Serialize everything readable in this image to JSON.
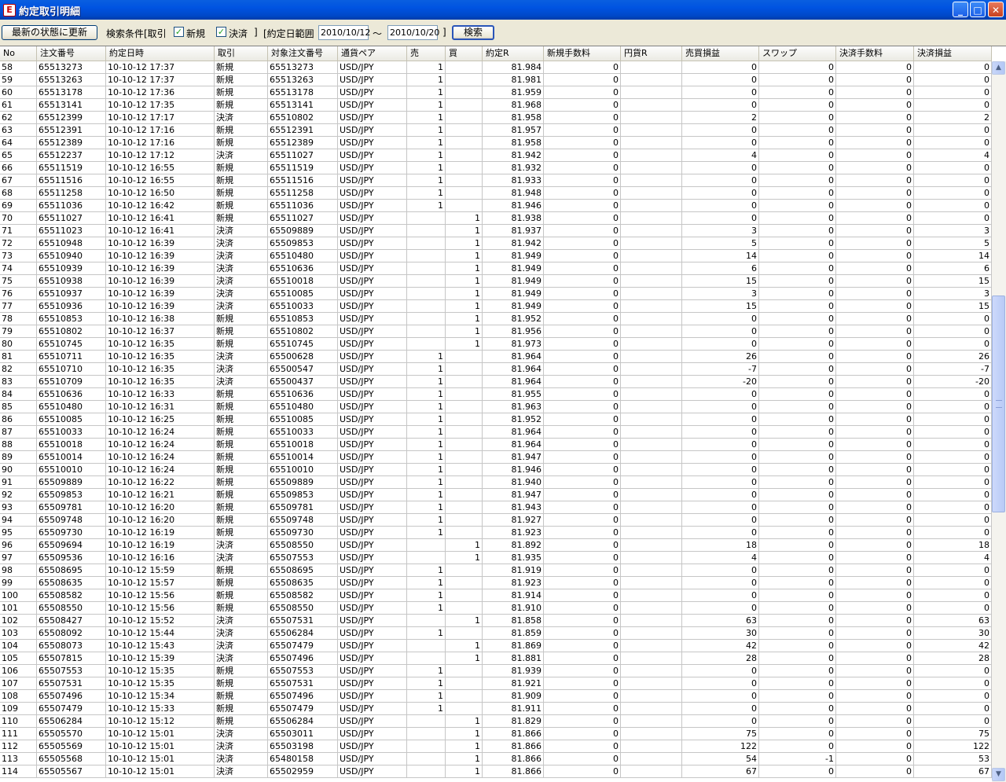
{
  "window": {
    "title": "約定取引明細"
  },
  "toolbar": {
    "refresh_label": "最新の状態に更新",
    "search_condition_label": "検索条件[取引",
    "new_checked": true,
    "new_label": "新規",
    "settle_checked": true,
    "settle_label": "決済",
    "bracket_close": "]",
    "date_range_label": "[約定日範囲",
    "date_from": "2010/10/12",
    "tilde": "〜",
    "date_to": "2010/10/20",
    "bracket_close2": "]",
    "search_label": "検索"
  },
  "table": {
    "columns": [
      "No",
      "注文番号",
      "約定日時",
      "取引",
      "対象注文番号",
      "通貨ペア",
      "売",
      "買",
      "約定R",
      "新規手数料",
      "円貨R",
      "売買損益",
      "スワップ",
      "決済手数料",
      "決済損益"
    ],
    "rows": [
      [
        "58",
        "65513273",
        "10-10-12 17:37",
        "新規",
        "65513273",
        "USD/JPY",
        "1",
        "",
        "81.984",
        "0",
        "",
        "0",
        "0",
        "0",
        "0"
      ],
      [
        "59",
        "65513263",
        "10-10-12 17:37",
        "新規",
        "65513263",
        "USD/JPY",
        "1",
        "",
        "81.981",
        "0",
        "",
        "0",
        "0",
        "0",
        "0"
      ],
      [
        "60",
        "65513178",
        "10-10-12 17:36",
        "新規",
        "65513178",
        "USD/JPY",
        "1",
        "",
        "81.959",
        "0",
        "",
        "0",
        "0",
        "0",
        "0"
      ],
      [
        "61",
        "65513141",
        "10-10-12 17:35",
        "新規",
        "65513141",
        "USD/JPY",
        "1",
        "",
        "81.968",
        "0",
        "",
        "0",
        "0",
        "0",
        "0"
      ],
      [
        "62",
        "65512399",
        "10-10-12 17:17",
        "決済",
        "65510802",
        "USD/JPY",
        "1",
        "",
        "81.958",
        "0",
        "",
        "2",
        "0",
        "0",
        "2"
      ],
      [
        "63",
        "65512391",
        "10-10-12 17:16",
        "新規",
        "65512391",
        "USD/JPY",
        "1",
        "",
        "81.957",
        "0",
        "",
        "0",
        "0",
        "0",
        "0"
      ],
      [
        "64",
        "65512389",
        "10-10-12 17:16",
        "新規",
        "65512389",
        "USD/JPY",
        "1",
        "",
        "81.958",
        "0",
        "",
        "0",
        "0",
        "0",
        "0"
      ],
      [
        "65",
        "65512237",
        "10-10-12 17:12",
        "決済",
        "65511027",
        "USD/JPY",
        "1",
        "",
        "81.942",
        "0",
        "",
        "4",
        "0",
        "0",
        "4"
      ],
      [
        "66",
        "65511519",
        "10-10-12 16:55",
        "新規",
        "65511519",
        "USD/JPY",
        "1",
        "",
        "81.932",
        "0",
        "",
        "0",
        "0",
        "0",
        "0"
      ],
      [
        "67",
        "65511516",
        "10-10-12 16:55",
        "新規",
        "65511516",
        "USD/JPY",
        "1",
        "",
        "81.933",
        "0",
        "",
        "0",
        "0",
        "0",
        "0"
      ],
      [
        "68",
        "65511258",
        "10-10-12 16:50",
        "新規",
        "65511258",
        "USD/JPY",
        "1",
        "",
        "81.948",
        "0",
        "",
        "0",
        "0",
        "0",
        "0"
      ],
      [
        "69",
        "65511036",
        "10-10-12 16:42",
        "新規",
        "65511036",
        "USD/JPY",
        "1",
        "",
        "81.946",
        "0",
        "",
        "0",
        "0",
        "0",
        "0"
      ],
      [
        "70",
        "65511027",
        "10-10-12 16:41",
        "新規",
        "65511027",
        "USD/JPY",
        "",
        "1",
        "81.938",
        "0",
        "",
        "0",
        "0",
        "0",
        "0"
      ],
      [
        "71",
        "65511023",
        "10-10-12 16:41",
        "決済",
        "65509889",
        "USD/JPY",
        "",
        "1",
        "81.937",
        "0",
        "",
        "3",
        "0",
        "0",
        "3"
      ],
      [
        "72",
        "65510948",
        "10-10-12 16:39",
        "決済",
        "65509853",
        "USD/JPY",
        "",
        "1",
        "81.942",
        "0",
        "",
        "5",
        "0",
        "0",
        "5"
      ],
      [
        "73",
        "65510940",
        "10-10-12 16:39",
        "決済",
        "65510480",
        "USD/JPY",
        "",
        "1",
        "81.949",
        "0",
        "",
        "14",
        "0",
        "0",
        "14"
      ],
      [
        "74",
        "65510939",
        "10-10-12 16:39",
        "決済",
        "65510636",
        "USD/JPY",
        "",
        "1",
        "81.949",
        "0",
        "",
        "6",
        "0",
        "0",
        "6"
      ],
      [
        "75",
        "65510938",
        "10-10-12 16:39",
        "決済",
        "65510018",
        "USD/JPY",
        "",
        "1",
        "81.949",
        "0",
        "",
        "15",
        "0",
        "0",
        "15"
      ],
      [
        "76",
        "65510937",
        "10-10-12 16:39",
        "決済",
        "65510085",
        "USD/JPY",
        "",
        "1",
        "81.949",
        "0",
        "",
        "3",
        "0",
        "0",
        "3"
      ],
      [
        "77",
        "65510936",
        "10-10-12 16:39",
        "決済",
        "65510033",
        "USD/JPY",
        "",
        "1",
        "81.949",
        "0",
        "",
        "15",
        "0",
        "0",
        "15"
      ],
      [
        "78",
        "65510853",
        "10-10-12 16:38",
        "新規",
        "65510853",
        "USD/JPY",
        "",
        "1",
        "81.952",
        "0",
        "",
        "0",
        "0",
        "0",
        "0"
      ],
      [
        "79",
        "65510802",
        "10-10-12 16:37",
        "新規",
        "65510802",
        "USD/JPY",
        "",
        "1",
        "81.956",
        "0",
        "",
        "0",
        "0",
        "0",
        "0"
      ],
      [
        "80",
        "65510745",
        "10-10-12 16:35",
        "新規",
        "65510745",
        "USD/JPY",
        "",
        "1",
        "81.973",
        "0",
        "",
        "0",
        "0",
        "0",
        "0"
      ],
      [
        "81",
        "65510711",
        "10-10-12 16:35",
        "決済",
        "65500628",
        "USD/JPY",
        "1",
        "",
        "81.964",
        "0",
        "",
        "26",
        "0",
        "0",
        "26"
      ],
      [
        "82",
        "65510710",
        "10-10-12 16:35",
        "決済",
        "65500547",
        "USD/JPY",
        "1",
        "",
        "81.964",
        "0",
        "",
        "-7",
        "0",
        "0",
        "-7"
      ],
      [
        "83",
        "65510709",
        "10-10-12 16:35",
        "決済",
        "65500437",
        "USD/JPY",
        "1",
        "",
        "81.964",
        "0",
        "",
        "-20",
        "0",
        "0",
        "-20"
      ],
      [
        "84",
        "65510636",
        "10-10-12 16:33",
        "新規",
        "65510636",
        "USD/JPY",
        "1",
        "",
        "81.955",
        "0",
        "",
        "0",
        "0",
        "0",
        "0"
      ],
      [
        "85",
        "65510480",
        "10-10-12 16:31",
        "新規",
        "65510480",
        "USD/JPY",
        "1",
        "",
        "81.963",
        "0",
        "",
        "0",
        "0",
        "0",
        "0"
      ],
      [
        "86",
        "65510085",
        "10-10-12 16:25",
        "新規",
        "65510085",
        "USD/JPY",
        "1",
        "",
        "81.952",
        "0",
        "",
        "0",
        "0",
        "0",
        "0"
      ],
      [
        "87",
        "65510033",
        "10-10-12 16:24",
        "新規",
        "65510033",
        "USD/JPY",
        "1",
        "",
        "81.964",
        "0",
        "",
        "0",
        "0",
        "0",
        "0"
      ],
      [
        "88",
        "65510018",
        "10-10-12 16:24",
        "新規",
        "65510018",
        "USD/JPY",
        "1",
        "",
        "81.964",
        "0",
        "",
        "0",
        "0",
        "0",
        "0"
      ],
      [
        "89",
        "65510014",
        "10-10-12 16:24",
        "新規",
        "65510014",
        "USD/JPY",
        "1",
        "",
        "81.947",
        "0",
        "",
        "0",
        "0",
        "0",
        "0"
      ],
      [
        "90",
        "65510010",
        "10-10-12 16:24",
        "新規",
        "65510010",
        "USD/JPY",
        "1",
        "",
        "81.946",
        "0",
        "",
        "0",
        "0",
        "0",
        "0"
      ],
      [
        "91",
        "65509889",
        "10-10-12 16:22",
        "新規",
        "65509889",
        "USD/JPY",
        "1",
        "",
        "81.940",
        "0",
        "",
        "0",
        "0",
        "0",
        "0"
      ],
      [
        "92",
        "65509853",
        "10-10-12 16:21",
        "新規",
        "65509853",
        "USD/JPY",
        "1",
        "",
        "81.947",
        "0",
        "",
        "0",
        "0",
        "0",
        "0"
      ],
      [
        "93",
        "65509781",
        "10-10-12 16:20",
        "新規",
        "65509781",
        "USD/JPY",
        "1",
        "",
        "81.943",
        "0",
        "",
        "0",
        "0",
        "0",
        "0"
      ],
      [
        "94",
        "65509748",
        "10-10-12 16:20",
        "新規",
        "65509748",
        "USD/JPY",
        "1",
        "",
        "81.927",
        "0",
        "",
        "0",
        "0",
        "0",
        "0"
      ],
      [
        "95",
        "65509730",
        "10-10-12 16:19",
        "新規",
        "65509730",
        "USD/JPY",
        "1",
        "",
        "81.923",
        "0",
        "",
        "0",
        "0",
        "0",
        "0"
      ],
      [
        "96",
        "65509694",
        "10-10-12 16:19",
        "決済",
        "65508550",
        "USD/JPY",
        "",
        "1",
        "81.892",
        "0",
        "",
        "18",
        "0",
        "0",
        "18"
      ],
      [
        "97",
        "65509536",
        "10-10-12 16:16",
        "決済",
        "65507553",
        "USD/JPY",
        "",
        "1",
        "81.935",
        "0",
        "",
        "4",
        "0",
        "0",
        "4"
      ],
      [
        "98",
        "65508695",
        "10-10-12 15:59",
        "新規",
        "65508695",
        "USD/JPY",
        "1",
        "",
        "81.919",
        "0",
        "",
        "0",
        "0",
        "0",
        "0"
      ],
      [
        "99",
        "65508635",
        "10-10-12 15:57",
        "新規",
        "65508635",
        "USD/JPY",
        "1",
        "",
        "81.923",
        "0",
        "",
        "0",
        "0",
        "0",
        "0"
      ],
      [
        "100",
        "65508582",
        "10-10-12 15:56",
        "新規",
        "65508582",
        "USD/JPY",
        "1",
        "",
        "81.914",
        "0",
        "",
        "0",
        "0",
        "0",
        "0"
      ],
      [
        "101",
        "65508550",
        "10-10-12 15:56",
        "新規",
        "65508550",
        "USD/JPY",
        "1",
        "",
        "81.910",
        "0",
        "",
        "0",
        "0",
        "0",
        "0"
      ],
      [
        "102",
        "65508427",
        "10-10-12 15:52",
        "決済",
        "65507531",
        "USD/JPY",
        "",
        "1",
        "81.858",
        "0",
        "",
        "63",
        "0",
        "0",
        "63"
      ],
      [
        "103",
        "65508092",
        "10-10-12 15:44",
        "決済",
        "65506284",
        "USD/JPY",
        "1",
        "",
        "81.859",
        "0",
        "",
        "30",
        "0",
        "0",
        "30"
      ],
      [
        "104",
        "65508073",
        "10-10-12 15:43",
        "決済",
        "65507479",
        "USD/JPY",
        "",
        "1",
        "81.869",
        "0",
        "",
        "42",
        "0",
        "0",
        "42"
      ],
      [
        "105",
        "65507815",
        "10-10-12 15:39",
        "決済",
        "65507496",
        "USD/JPY",
        "",
        "1",
        "81.881",
        "0",
        "",
        "28",
        "0",
        "0",
        "28"
      ],
      [
        "106",
        "65507553",
        "10-10-12 15:35",
        "新規",
        "65507553",
        "USD/JPY",
        "1",
        "",
        "81.939",
        "0",
        "",
        "0",
        "0",
        "0",
        "0"
      ],
      [
        "107",
        "65507531",
        "10-10-12 15:35",
        "新規",
        "65507531",
        "USD/JPY",
        "1",
        "",
        "81.921",
        "0",
        "",
        "0",
        "0",
        "0",
        "0"
      ],
      [
        "108",
        "65507496",
        "10-10-12 15:34",
        "新規",
        "65507496",
        "USD/JPY",
        "1",
        "",
        "81.909",
        "0",
        "",
        "0",
        "0",
        "0",
        "0"
      ],
      [
        "109",
        "65507479",
        "10-10-12 15:33",
        "新規",
        "65507479",
        "USD/JPY",
        "1",
        "",
        "81.911",
        "0",
        "",
        "0",
        "0",
        "0",
        "0"
      ],
      [
        "110",
        "65506284",
        "10-10-12 15:12",
        "新規",
        "65506284",
        "USD/JPY",
        "",
        "1",
        "81.829",
        "0",
        "",
        "0",
        "0",
        "0",
        "0"
      ],
      [
        "111",
        "65505570",
        "10-10-12 15:01",
        "決済",
        "65503011",
        "USD/JPY",
        "",
        "1",
        "81.866",
        "0",
        "",
        "75",
        "0",
        "0",
        "75"
      ],
      [
        "112",
        "65505569",
        "10-10-12 15:01",
        "決済",
        "65503198",
        "USD/JPY",
        "",
        "1",
        "81.866",
        "0",
        "",
        "122",
        "0",
        "0",
        "122"
      ],
      [
        "113",
        "65505568",
        "10-10-12 15:01",
        "決済",
        "65480158",
        "USD/JPY",
        "",
        "1",
        "81.866",
        "0",
        "",
        "54",
        "-1",
        "0",
        "53"
      ],
      [
        "114",
        "65505567",
        "10-10-12 15:01",
        "決済",
        "65502959",
        "USD/JPY",
        "",
        "1",
        "81.866",
        "0",
        "",
        "67",
        "0",
        "0",
        "67"
      ]
    ]
  },
  "icons": {
    "app": "app-icon",
    "minimize": "minimize-icon",
    "maximize": "maximize-icon",
    "close": "close-icon",
    "check": "checkbox-check-icon",
    "scroll_up": "scroll-up-arrow-icon",
    "scroll_down": "scroll-down-arrow-icon"
  },
  "colors": {
    "titlebar": "#0053e1",
    "window_bg": "#ece9d8",
    "grid_line": "#c6c6c6",
    "check": "#21a121"
  }
}
